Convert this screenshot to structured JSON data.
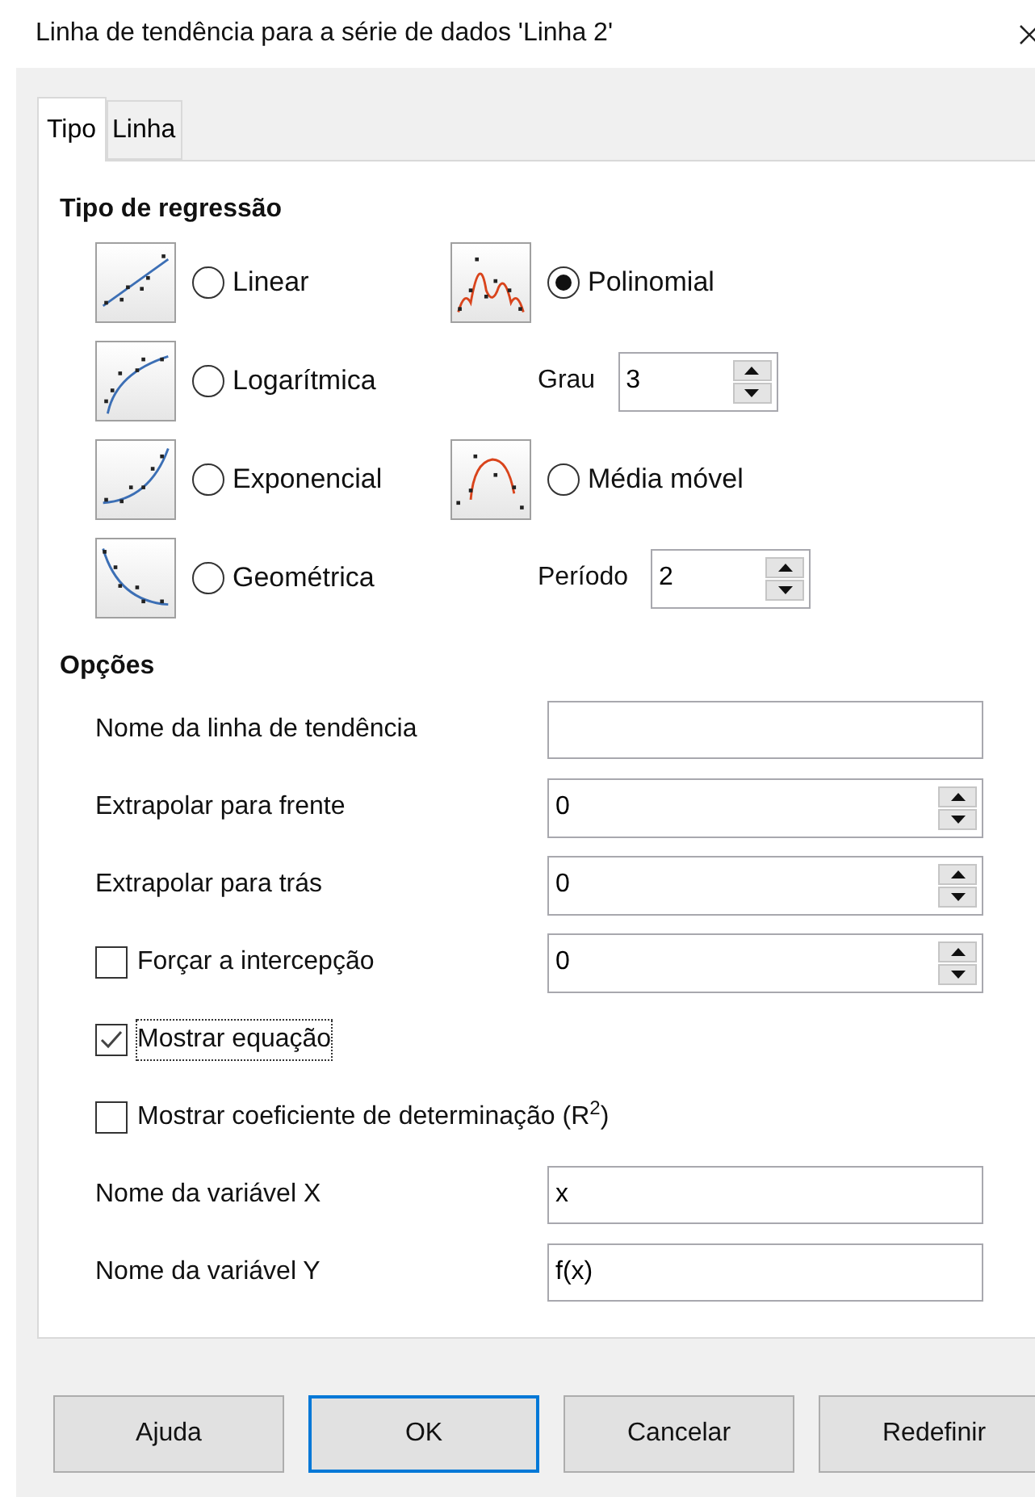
{
  "window": {
    "title": "Linha de tendência para a série de dados 'Linha 2'"
  },
  "tabs": [
    {
      "label": "Tipo",
      "selected": true
    },
    {
      "label": "Linha",
      "selected": false
    }
  ],
  "regression": {
    "heading": "Tipo de regressão",
    "types": [
      {
        "label": "Linear",
        "selected": false
      },
      {
        "label": "Logarítmica",
        "selected": false
      },
      {
        "label": "Exponencial",
        "selected": false
      },
      {
        "label": "Geométrica",
        "selected": false
      },
      {
        "label": "Polinomial",
        "selected": true
      },
      {
        "label": "Média móvel",
        "selected": false
      }
    ],
    "degree": {
      "label": "Grau",
      "value": "3"
    },
    "period": {
      "label": "Período",
      "value": "2"
    }
  },
  "options": {
    "heading": "Opções",
    "rows": [
      {
        "kind": "text",
        "label": "Nome da linha de tendência"
      },
      {
        "kind": "spin",
        "label": "Extrapolar para frente",
        "value": "0"
      },
      {
        "kind": "spin",
        "label": "Extrapolar para trás",
        "value": "0"
      },
      {
        "kind": "check-spin",
        "label": "Forçar a intercepção",
        "checked": false,
        "focused": false,
        "value": "0"
      },
      {
        "kind": "check",
        "label": "Mostrar equação",
        "checked": true,
        "focused": true
      },
      {
        "kind": "check",
        "label": "Mostrar coeficiente de determinação (R$^{2}$)",
        "checked": false,
        "focused": false
      },
      {
        "kind": "text",
        "label": "Nome da variável X",
        "value": "x"
      },
      {
        "kind": "text",
        "label": "Nome da variável Y",
        "value": "f(x)"
      }
    ]
  },
  "buttons": [
    {
      "label": "Ajuda",
      "default": false
    },
    {
      "label": "OK",
      "default": true
    },
    {
      "label": "Cancelar",
      "default": false
    },
    {
      "label": "Redefinir",
      "default": false
    }
  ]
}
